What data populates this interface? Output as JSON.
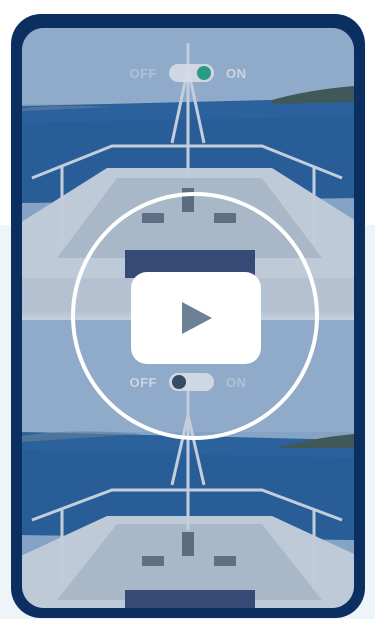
{
  "top_toggle": {
    "off_label": "OFF",
    "on_label": "ON",
    "state": "on"
  },
  "bottom_toggle": {
    "off_label": "OFF",
    "on_label": "ON",
    "state": "off"
  },
  "colors": {
    "frame": "#0b2f61",
    "toggle_on": "#2ab089",
    "toggle_off": "#3d4f63",
    "sea": "#2e6aa8",
    "sky": "#a9c3df"
  },
  "icons": {
    "play": "play-icon"
  }
}
